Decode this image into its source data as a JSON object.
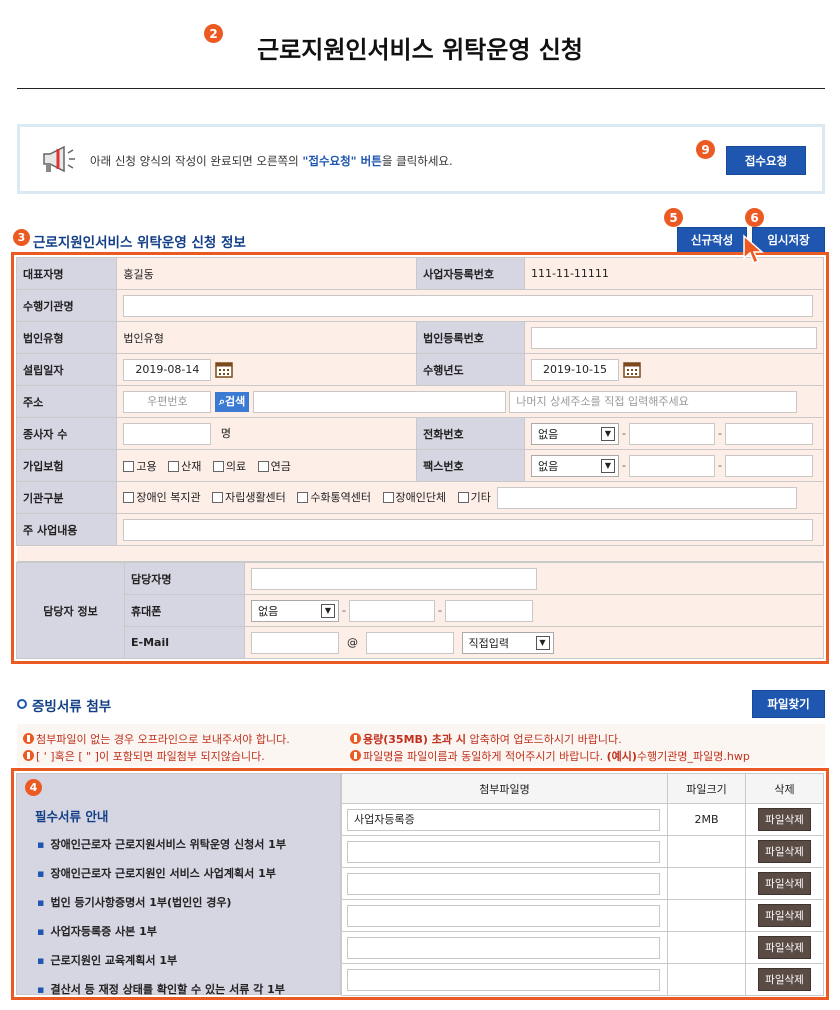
{
  "page": {
    "title": "근로지원인서비스 위탁운영 신청"
  },
  "badges": {
    "b2": "2",
    "b9": "9",
    "b3": "3",
    "b5": "5",
    "b6": "6",
    "b4": "4"
  },
  "notice": {
    "text_before": "아래 신청 양식의 작성이 완료되면 오른쪽의 ",
    "highlight": "\"접수요청\" 버튼",
    "text_after": "을 클릭하세요.",
    "submit_label": "접수요청",
    "icon": "megaphone-icon"
  },
  "info": {
    "title": "근로지원인서비스 위탁운영 신청 정보",
    "new_label": "신규작성",
    "save_label": "임시저장",
    "rep_name": {
      "label": "대표자명",
      "value": "홍길동"
    },
    "biz_no": {
      "label": "사업자등록번호",
      "value": "111-11-11111"
    },
    "agency": {
      "label": "수행기관명"
    },
    "corp_type": {
      "label": "법인유형",
      "value": "법인유형"
    },
    "corp_no": {
      "label": "법인등록번호"
    },
    "est_date": {
      "label": "설립일자",
      "value": "2019-08-14"
    },
    "perf_year": {
      "label": "수행년도",
      "value": "2019-10-15"
    },
    "address": {
      "label": "주소",
      "zip_placeholder": "우편번호",
      "search_label": "검색",
      "detail_placeholder": "나머지 상세주소를 직접 입력해주세요"
    },
    "employees": {
      "label": "종사자 수",
      "unit": "명"
    },
    "phone": {
      "label": "전화번호",
      "select": "없음"
    },
    "insurance": {
      "label": "가입보험",
      "options": [
        "고용",
        "산재",
        "의료",
        "연금"
      ]
    },
    "fax": {
      "label": "팩스번호",
      "select": "없음"
    },
    "org_type": {
      "label": "기관구분",
      "options": [
        "장애인 복지관",
        "자립생활센터",
        "수화통역센터",
        "장애인단체",
        "기타"
      ]
    },
    "main_biz": {
      "label": "주 사업내용"
    },
    "manager": {
      "section_label": "담당자 정보",
      "name_label": "담당자명",
      "mobile_label": "휴대폰",
      "mobile_select": "없음",
      "email_label": "E-Mail",
      "at": "@",
      "email_select": "직접입력"
    }
  },
  "attach": {
    "title": "증빙서류 첨부",
    "find_label": "파일찾기",
    "warnings": [
      {
        "text": "첨부파일이 없는 경우 오프라인으로 보내주셔야 합니다."
      },
      {
        "text": "[ ' ]혹은 [ \" ]이 포함되면 파일첨부 되지않습니다."
      },
      {
        "bold": "용량(35MB) 초과 시",
        "text": " 압축하여 업로드하시기 바랍니다."
      },
      {
        "text": "파일명을 파일이름과 동일하게 적어주시기 바랍니다. ",
        "bold": "(예시)",
        "text2": "수행기관명_파일명.hwp"
      }
    ],
    "req_title": "필수서류 안내",
    "req_items": [
      "장애인근로자 근로지원서비스 위탁운영 신청서 1부",
      "장애인근로자 근로지원인 서비스 사업계획서 1부",
      "법인 등기사항증명서 1부(법인인 경우)",
      "사업자등록증 사본 1부",
      "근로지원인 교육계획서 1부",
      "결산서 등 재정 상태를 확인할 수 있는 서류 각 1부"
    ],
    "col_file": "첨부파일명",
    "col_size": "파일크기",
    "col_del": "삭제",
    "rows": [
      {
        "file": "사업자등록증",
        "size": "2MB",
        "del": "파일삭제"
      },
      {
        "file": "",
        "size": "",
        "del": "파일삭제"
      },
      {
        "file": "",
        "size": "",
        "del": "파일삭제"
      },
      {
        "file": "",
        "size": "",
        "del": "파일삭제"
      },
      {
        "file": "",
        "size": "",
        "del": "파일삭제"
      },
      {
        "file": "",
        "size": "",
        "del": "파일삭제"
      }
    ]
  }
}
